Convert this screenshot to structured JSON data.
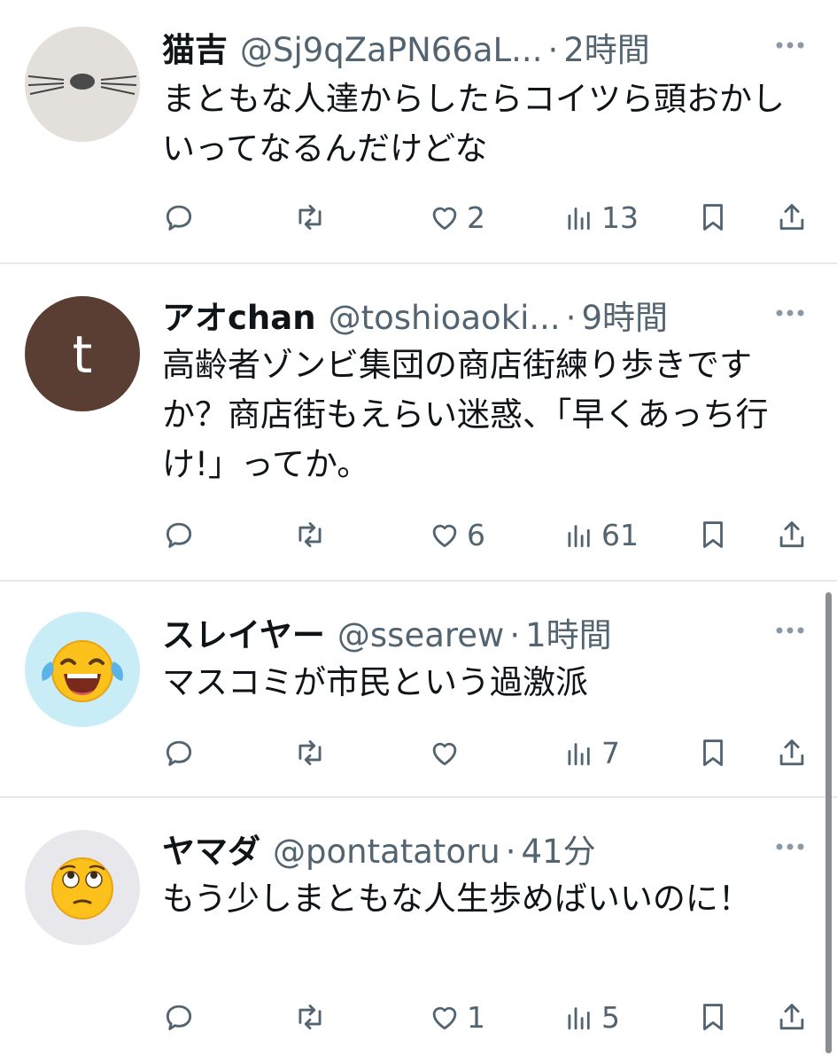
{
  "tweets": [
    {
      "name": "猫吉",
      "handle": "@Sj9qZaPN66aL...",
      "time": "2時間",
      "text": "まともな人達からしたらコイツら頭おかしいってなるんだけどな",
      "avatar": "seal-face",
      "reply_count": "",
      "retweet_count": "",
      "like_count": "2",
      "view_count": "13"
    },
    {
      "name": "アオchan",
      "handle": "@toshioaoki...",
      "time": "9時間",
      "text": "高齢者ゾンビ集団の商店街練り歩きですか？商店街もえらい迷惑、「早くあっち行け!」ってか。",
      "avatar": "letter-t",
      "avatar_letter": "t",
      "reply_count": "",
      "retweet_count": "",
      "like_count": "6",
      "view_count": "61"
    },
    {
      "name": "スレイヤー",
      "handle": "@ssearew",
      "time": "1時間",
      "text": "マスコミが市民という過激派",
      "avatar": "laughing-crying-emoji",
      "reply_count": "",
      "retweet_count": "",
      "like_count": "",
      "view_count": "7"
    },
    {
      "name": "ヤマダ",
      "handle": "@pontatatoru",
      "time": "41分",
      "text": "もう少しまともな人生歩めばいいのに！",
      "avatar": "eye-roll-emoji",
      "reply_count": "",
      "retweet_count": "",
      "like_count": "1",
      "view_count": "5"
    }
  ],
  "separator": "·",
  "colors": {
    "text": "#0f1419",
    "secondary": "#536471",
    "divider": "#e6e8ea",
    "avatar_t_bg": "#5a3d33",
    "avatar_light_blue": "#c9edf7",
    "avatar_light_gray": "#e8e8ec"
  },
  "icons": [
    "reply-icon",
    "retweet-icon",
    "like-icon",
    "views-icon",
    "bookmark-icon",
    "share-icon",
    "more-icon"
  ]
}
